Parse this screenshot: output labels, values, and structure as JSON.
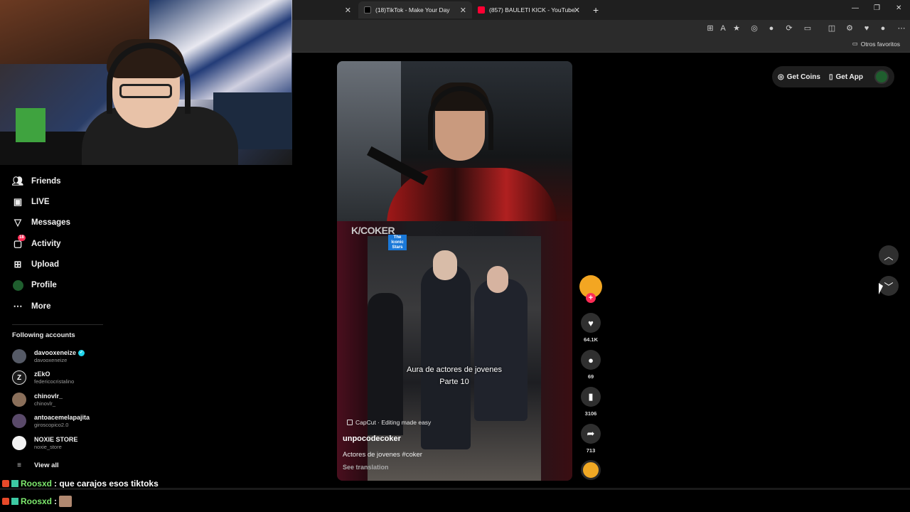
{
  "browser": {
    "tabs": [
      {
        "label": "(18)TikTok - Make Your Day",
        "active": true
      },
      {
        "label": "(857) BAULETI KICK - YouTube",
        "active": false
      }
    ],
    "favorites_other": "Otros favoritos"
  },
  "sidebar": {
    "items": [
      {
        "label": "Friends",
        "icon": "friends-icon"
      },
      {
        "label": "LIVE",
        "icon": "live-icon"
      },
      {
        "label": "Messages",
        "icon": "messages-icon"
      },
      {
        "label": "Activity",
        "icon": "activity-icon",
        "badge": "18"
      },
      {
        "label": "Upload",
        "icon": "upload-icon"
      },
      {
        "label": "Profile",
        "icon": "profile-icon"
      },
      {
        "label": "More",
        "icon": "more-icon"
      }
    ],
    "following_title": "Following accounts",
    "accounts": [
      {
        "name": "davooxeneize",
        "handle": "davooxeneize",
        "verified": true
      },
      {
        "name": "zEkO",
        "handle": "federicocristalino"
      },
      {
        "name": "chinovlr_",
        "handle": "chinovlr_"
      },
      {
        "name": "antoacemelapajita",
        "handle": "giroscopico2.0"
      },
      {
        "name": "NOXIE STORE",
        "handle": "noxie_store"
      }
    ],
    "view_all": "View all"
  },
  "chat": [
    {
      "user": "Roosxd",
      "message": ": que carajos esos tiktoks"
    },
    {
      "user": "Roosxd",
      "message": ":"
    }
  ],
  "video": {
    "watermark": "K/COKER",
    "tag": "The Iconic Stars",
    "caption_line1": "Aura de actores de jovenes",
    "caption_line2": "Parte 10",
    "capcut": "CapCut · Editing made easy",
    "author": "unpocodecoker",
    "description": "Actores de jovenes #coker",
    "see_translation": "See translation"
  },
  "actions": {
    "likes": "64.1K",
    "comments": "69",
    "saves": "3106",
    "shares": "713"
  },
  "header": {
    "get_coins": "Get Coins",
    "get_app": "Get App"
  },
  "colors": {
    "accent": "#fe2c55",
    "chat_user": "#7de86d",
    "verified": "#20d5ec"
  }
}
